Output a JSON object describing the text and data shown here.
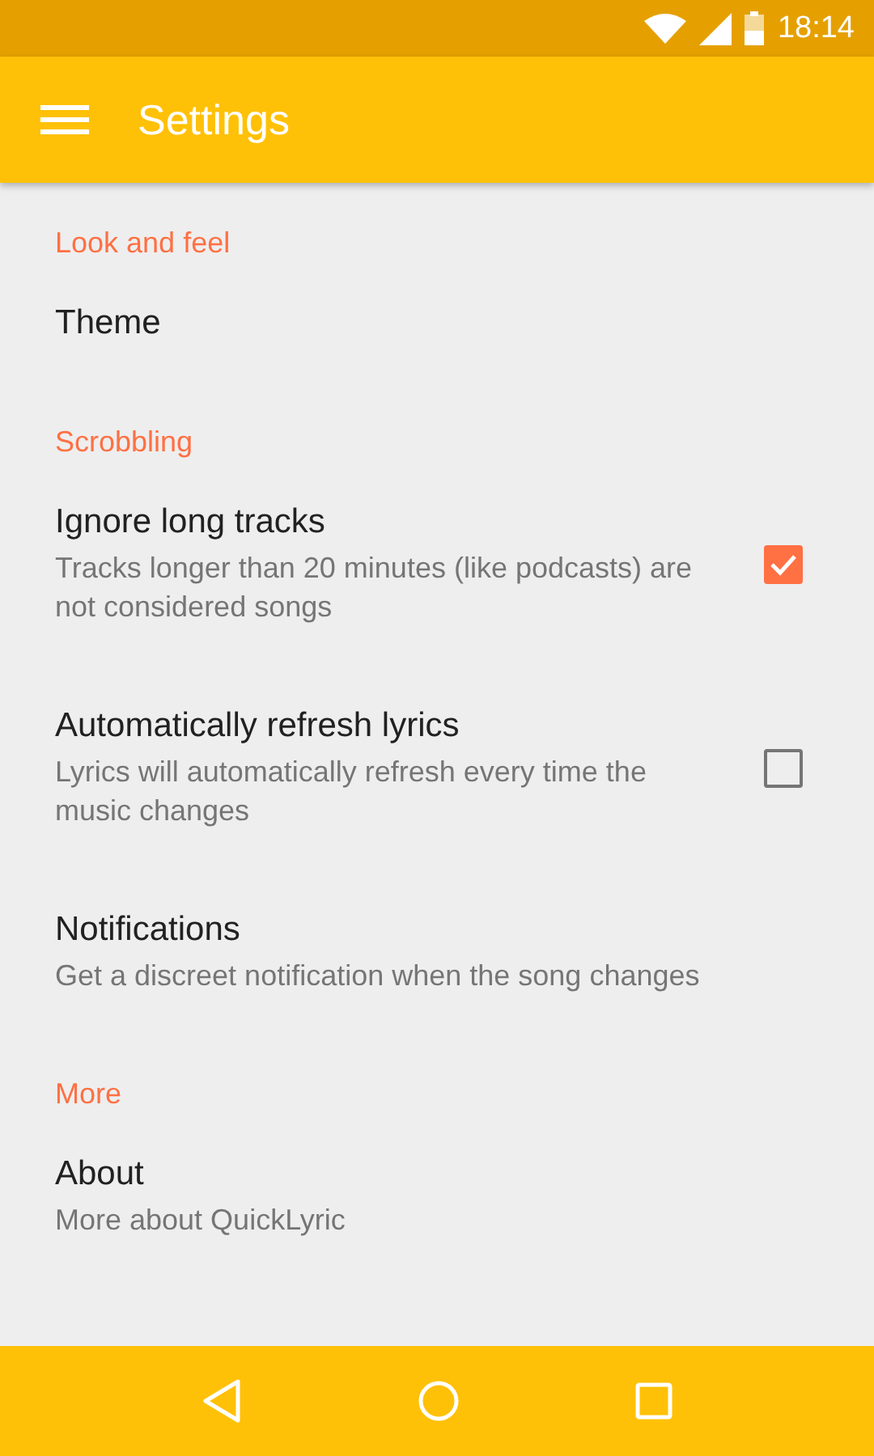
{
  "status_bar": {
    "time": "18:14"
  },
  "app_bar": {
    "title": "Settings"
  },
  "sections": [
    {
      "title": "Look and feel",
      "items": [
        {
          "kind": "plain",
          "title": "Theme"
        }
      ]
    },
    {
      "title": "Scrobbling",
      "items": [
        {
          "kind": "checkbox",
          "title": "Ignore long tracks",
          "summary": "Tracks longer than 20 minutes (like podcasts) are not considered songs",
          "checked": true
        },
        {
          "kind": "checkbox",
          "title": "Automatically refresh lyrics",
          "summary": "Lyrics will automatically refresh every time the music changes",
          "checked": false
        },
        {
          "kind": "plain",
          "title": "Notifications",
          "summary": "Get a discreet notification when the song changes"
        }
      ]
    },
    {
      "title": "More",
      "items": [
        {
          "kind": "plain",
          "title": "About",
          "summary": "More about QuickLyric"
        }
      ]
    }
  ]
}
